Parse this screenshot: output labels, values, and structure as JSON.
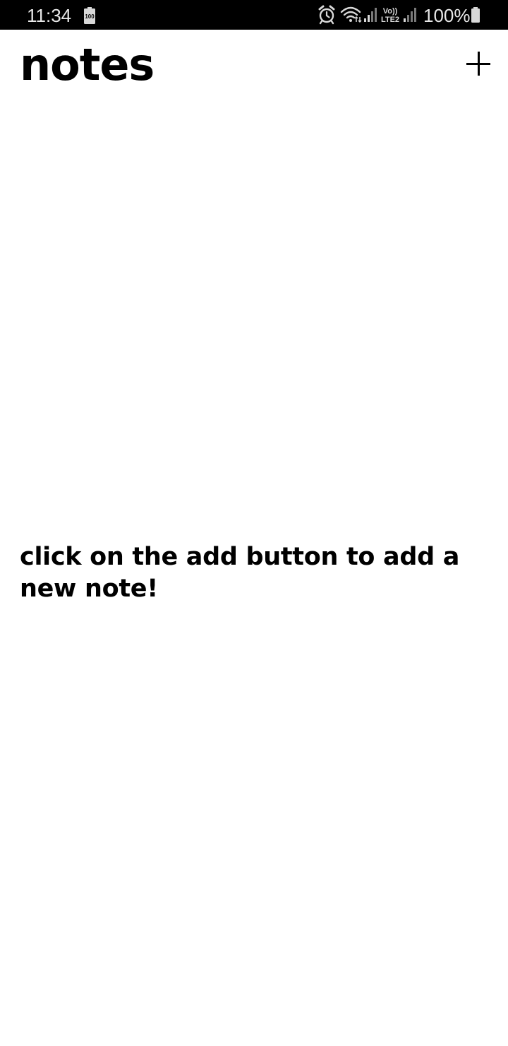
{
  "status_bar": {
    "time": "11:34",
    "battery_percent": "100%",
    "left_icons": [
      "battery-saver-icon"
    ],
    "right_icons": [
      "alarm-icon",
      "wifi-icon",
      "signal-icon",
      "volte-icon",
      "signal-icon",
      "battery-icon"
    ],
    "volte_label_top": "Vo))",
    "volte_label_bottom": "LTE2"
  },
  "header": {
    "title": "notes",
    "add_icon": "plus-icon"
  },
  "main": {
    "empty_message": "click on the add button to add a new note!"
  },
  "colors": {
    "background": "#ffffff",
    "status_bar": "#000000",
    "text": "#000000"
  }
}
